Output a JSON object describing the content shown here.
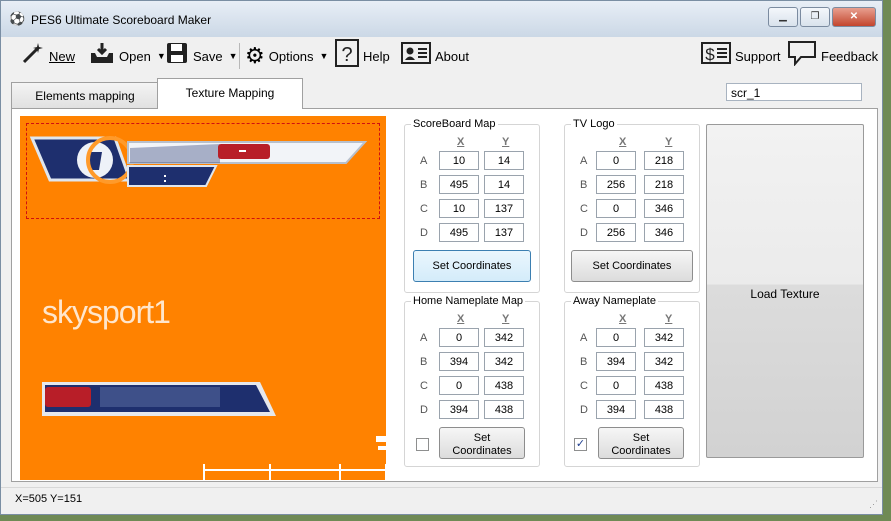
{
  "window": {
    "title": "PES6 Ultimate Scoreboard Maker",
    "controls": [
      "▁",
      "❐",
      "✕"
    ]
  },
  "toolbar": {
    "new_label": "New",
    "open_label": "Open",
    "save_label": "Save",
    "options_label": "Options",
    "help_label": "Help",
    "about_label": "About",
    "support_label": "Support",
    "feedback_label": "Feedback"
  },
  "tabs": [
    {
      "label": "Elements mapping"
    },
    {
      "label": "Texture Mapping"
    }
  ],
  "scr_field": {
    "value": "scr_1"
  },
  "texture": {
    "logo_text": "skysport1"
  },
  "groups": {
    "scoreboard_map": {
      "title": "ScoreBoard Map",
      "col_x": "X",
      "col_y": "Y",
      "rows": [
        {
          "label": "A",
          "x": "10",
          "y": "14"
        },
        {
          "label": "B",
          "x": "495",
          "y": "14"
        },
        {
          "label": "C",
          "x": "10",
          "y": "137"
        },
        {
          "label": "D",
          "x": "495",
          "y": "137"
        }
      ],
      "button": "Set Coordinates"
    },
    "tv_logo": {
      "title": "TV Logo",
      "col_x": "X",
      "col_y": "Y",
      "rows": [
        {
          "label": "A",
          "x": "0",
          "y": "218"
        },
        {
          "label": "B",
          "x": "256",
          "y": "218"
        },
        {
          "label": "C",
          "x": "0",
          "y": "346"
        },
        {
          "label": "D",
          "x": "256",
          "y": "346"
        }
      ],
      "button": "Set Coordinates"
    },
    "home_nameplate": {
      "title": "Home Nameplate Map",
      "col_x": "X",
      "col_y": "Y",
      "rows": [
        {
          "label": "A",
          "x": "0",
          "y": "342"
        },
        {
          "label": "B",
          "x": "394",
          "y": "342"
        },
        {
          "label": "C",
          "x": "0",
          "y": "438"
        },
        {
          "label": "D",
          "x": "394",
          "y": "438"
        }
      ],
      "button_line1": "Set",
      "button_line2": "Coordinates",
      "checked": false
    },
    "away_nameplate": {
      "title": "Away Nameplate",
      "col_x": "X",
      "col_y": "Y",
      "rows": [
        {
          "label": "A",
          "x": "0",
          "y": "342"
        },
        {
          "label": "B",
          "x": "394",
          "y": "342"
        },
        {
          "label": "C",
          "x": "0",
          "y": "438"
        },
        {
          "label": "D",
          "x": "394",
          "y": "438"
        }
      ],
      "button_line1": "Set",
      "button_line2": "Coordinates",
      "checked": true
    }
  },
  "load_texture_label": "Load Texture",
  "status": {
    "coords": "X=505  Y=151"
  },
  "colors": {
    "texture_bg": "#ff8200",
    "accent_red": "#c0202a",
    "bar_navy": "#1e2f6e"
  },
  "icons": {
    "new": "magic-wand-icon",
    "open": "inbox-tray-icon",
    "save": "floppy-disk-icon",
    "options": "gears-icon",
    "help": "question-mark-icon",
    "about": "id-card-icon",
    "support": "dollar-list-icon",
    "feedback": "speech-bubble-icon"
  }
}
